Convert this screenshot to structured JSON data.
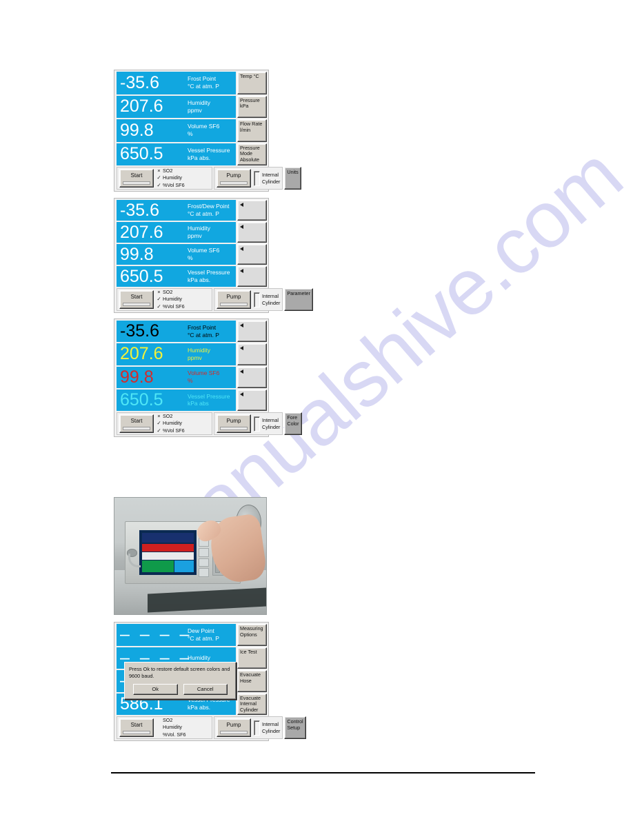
{
  "document": {
    "watermark": "manualshive.com"
  },
  "panels": [
    {
      "id": "panel-units",
      "rows": [
        {
          "value": "-35.6",
          "label1": "Frost Point",
          "label2": "°C at atm. P",
          "fore": "white"
        },
        {
          "value": "207.6",
          "label1": "Humidity",
          "label2": "ppmv",
          "fore": "white"
        },
        {
          "value": "99.8",
          "label1": "Volume SF6",
          "label2": "%",
          "fore": "white"
        },
        {
          "value": "650.5",
          "label1": "Vessel Pressure",
          "label2": "kPa abs.",
          "fore": "white"
        }
      ],
      "side_buttons": [
        {
          "line1": "Temp °C",
          "line2": "",
          "line3": "",
          "style": "normal"
        },
        {
          "line1": "Pressure",
          "line2": "kPa",
          "line3": "",
          "style": "normal"
        },
        {
          "line1": "Flow Rate",
          "line2": "l/min",
          "line3": "",
          "style": "normal"
        },
        {
          "line1": "Pressure",
          "line2": "Mode",
          "line3": "Absolute",
          "style": "normal"
        }
      ],
      "controls": {
        "start_label": "Start",
        "checks": [
          {
            "mark": "×",
            "label": "SO2"
          },
          {
            "mark": "✓",
            "label": "Humidity"
          },
          {
            "mark": "✓",
            "label": "%Vol SF6"
          }
        ],
        "pump_label": "Pump",
        "cylinder_label1": "Internal",
        "cylinder_label2": "Cylinder",
        "end_button": "Units"
      }
    },
    {
      "id": "panel-parameter",
      "rows": [
        {
          "value": "-35.6",
          "label1": "Frost/Dew Point",
          "label2": "°C at atm. P",
          "fore": "white"
        },
        {
          "value": "207.6",
          "label1": "Humidity",
          "label2": "ppmv",
          "fore": "white"
        },
        {
          "value": "99.8",
          "label1": "Volume SF6",
          "label2": "%",
          "fore": "white"
        },
        {
          "value": "650.5",
          "label1": "Vessel Pressure",
          "label2": "kPa abs.",
          "fore": "white"
        }
      ],
      "side_buttons": [
        {
          "line1": "",
          "line2": "",
          "line3": "",
          "style": "arrow"
        },
        {
          "line1": "",
          "line2": "",
          "line3": "",
          "style": "arrow"
        },
        {
          "line1": "",
          "line2": "",
          "line3": "",
          "style": "arrow"
        },
        {
          "line1": "",
          "line2": "",
          "line3": "",
          "style": "arrow"
        }
      ],
      "controls": {
        "start_label": "Start",
        "checks": [
          {
            "mark": "×",
            "label": "SO2"
          },
          {
            "mark": "✓",
            "label": "Humidity"
          },
          {
            "mark": "✓",
            "label": "%Vol SF6"
          }
        ],
        "pump_label": "Pump",
        "cylinder_label1": "Internal",
        "cylinder_label2": "Cylinder",
        "end_button": "Parameter"
      }
    },
    {
      "id": "panel-fore-color",
      "rows": [
        {
          "value": "-35.6",
          "label1": "Frost Point",
          "label2": "°C at atm. P",
          "fore": "black"
        },
        {
          "value": "207.6",
          "label1": "Humidity",
          "label2": "ppmv",
          "fore": "yellow"
        },
        {
          "value": "99.8",
          "label1": "Volume SF6",
          "label2": "%",
          "fore": "red"
        },
        {
          "value": "650.5",
          "label1": "Vessel Pressure",
          "label2": "kPa abs",
          "fore": "cyan"
        }
      ],
      "side_buttons": [
        {
          "line1": "",
          "line2": "",
          "line3": "",
          "style": "arrow"
        },
        {
          "line1": "",
          "line2": "",
          "line3": "",
          "style": "arrow"
        },
        {
          "line1": "",
          "line2": "",
          "line3": "",
          "style": "arrow"
        },
        {
          "line1": "",
          "line2": "",
          "line3": "",
          "style": "arrow"
        }
      ],
      "controls": {
        "start_label": "Start",
        "checks": [
          {
            "mark": "×",
            "label": "SO2"
          },
          {
            "mark": "✓",
            "label": "Humidity"
          },
          {
            "mark": "✓",
            "label": "%Vol SF6"
          }
        ],
        "pump_label": "Pump",
        "cylinder_label1": "Internal",
        "cylinder_label2": "Cylinder",
        "end_button": "Fore Color"
      }
    },
    {
      "id": "panel-control-setup",
      "rows": [
        {
          "value": "–  –  –  –",
          "label1": "Dew Point",
          "label2": "°C at atm. P",
          "fore": "white"
        },
        {
          "value": "–  –  –  –",
          "label1": "Humidity",
          "label2": "",
          "fore": "white"
        },
        {
          "value": "–",
          "label1": "",
          "label2": "",
          "fore": "white"
        },
        {
          "value": "586.1",
          "label1": "Vessel Pressure",
          "label2": "kPa abs.",
          "fore": "white"
        }
      ],
      "side_buttons": [
        {
          "line1": "Measuring",
          "line2": "Options",
          "line3": "",
          "style": "normal"
        },
        {
          "line1": "Ice Test",
          "line2": "",
          "line3": "",
          "style": "normal"
        },
        {
          "line1": "Evacuate",
          "line2": "Hose",
          "line3": "",
          "style": "normal"
        },
        {
          "line1": "Evacuate",
          "line2": "Internal",
          "line3": "Cylinder",
          "style": "normal"
        }
      ],
      "controls": {
        "start_label": "Start",
        "checks": [
          {
            "mark": "",
            "label": "SO2"
          },
          {
            "mark": "",
            "label": "Humidity"
          },
          {
            "mark": "",
            "label": "%Vol. SF6"
          }
        ],
        "pump_label": "Pump",
        "cylinder_label1": "Internal",
        "cylinder_label2": "Cylinder",
        "end_button": "Control\nSetup"
      },
      "dialog": {
        "message": "Press Ok to restore default screen colors and 9600 baud.",
        "ok_label": "Ok",
        "cancel_label": "Cancel"
      }
    }
  ],
  "photo": {
    "caption": ""
  },
  "colors": {
    "display_background": "#11a7e0",
    "display_foreground_white": "#ffffff",
    "fore_black": "#000000",
    "fore_yellow": "#f2f23a",
    "fore_red": "#d42b2b",
    "fore_cyan": "#4fe6f6",
    "button_face": "#d4d0c8",
    "button_accent": "#a9a9a9",
    "watermark": "#d8d8f4"
  }
}
